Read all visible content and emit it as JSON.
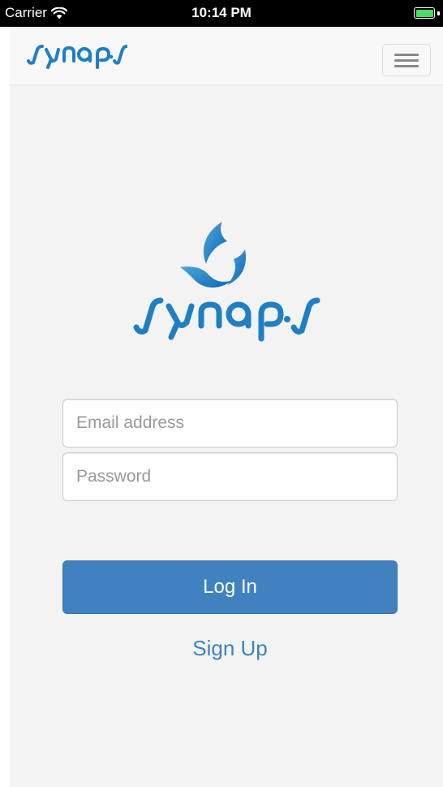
{
  "status_bar": {
    "carrier": "Carrier",
    "time": "10:14 PM",
    "wifi_icon": "wifi-icon",
    "battery_icon": "battery-icon"
  },
  "navbar": {
    "logo_icon": "synaps-logo-icon",
    "menu_icon": "hamburger-menu-icon"
  },
  "login_form": {
    "email_placeholder": "Email address",
    "email_value": "",
    "password_placeholder": "Password",
    "password_value": "",
    "login_label": "Log In",
    "signup_label": "Sign Up"
  },
  "colors": {
    "brand_blue": "#3f82bf",
    "logo_blue": "#1f7fc4",
    "page_background": "#f3f3f3",
    "navbar_background": "#f8f8f8",
    "status_bar_background": "#000000"
  }
}
